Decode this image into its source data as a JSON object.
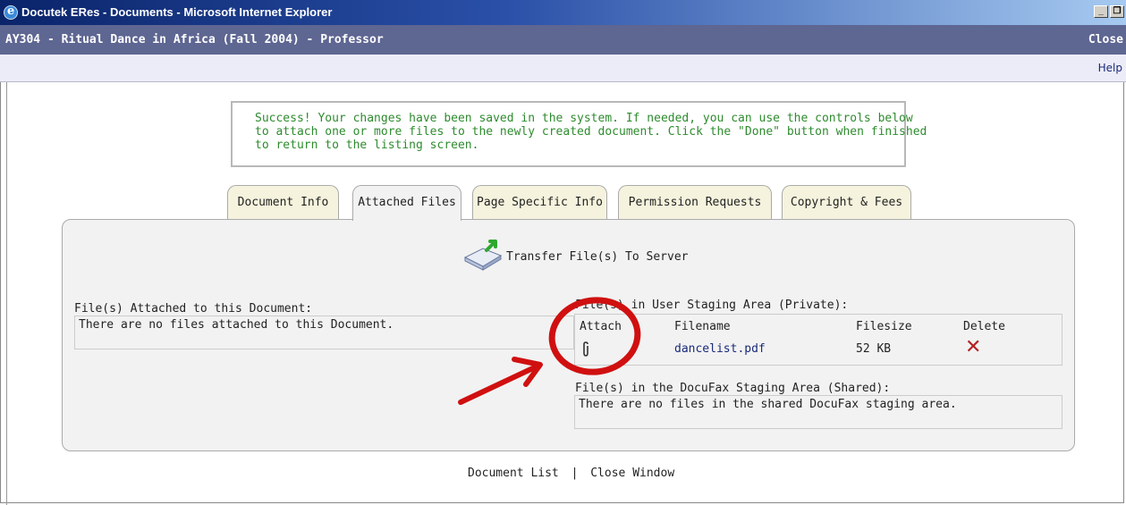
{
  "window": {
    "title": "Docutek ERes - Documents - Microsoft Internet Explorer",
    "min_glyph": "_",
    "restore_glyph": "❐"
  },
  "header": {
    "course_title": "AY304 - Ritual Dance in Africa (Fall 2004) - Professor",
    "close_label": "Close",
    "help_label": "Help"
  },
  "message": {
    "lines": [
      "Success! Your changes have been saved in the system. If needed, you can use the controls below",
      "to attach one or more files to the newly created document. Click the \"Done\" button when finished",
      "to return to the listing screen."
    ]
  },
  "tabs": [
    {
      "label": "Document Info",
      "active": false
    },
    {
      "label": "Attached Files",
      "active": true
    },
    {
      "label": "Page Specific Info",
      "active": false
    },
    {
      "label": "Permission Requests",
      "active": false
    },
    {
      "label": "Copyright & Fees",
      "active": false
    }
  ],
  "transfer": {
    "label": "Transfer File(s) To Server",
    "icon": "upload-to-server-icon"
  },
  "attached": {
    "label": "File(s) Attached to this Document:",
    "empty_text": "There are no files attached to this Document."
  },
  "staging": {
    "label": "File(s) in User Staging Area (Private):",
    "columns": [
      "Attach",
      "Filename",
      "Filesize",
      "Delete"
    ],
    "rows": [
      {
        "filename": "dancelist.pdf",
        "filesize": "52 KB",
        "attach_icon": "paperclip-icon",
        "delete_icon": "delete-x-icon"
      }
    ]
  },
  "docufax": {
    "label": "File(s) in the DocuFax Staging Area (Shared):",
    "empty_text": "There are no files in the shared DocuFax staging area."
  },
  "footer": {
    "document_list": "Document List",
    "separator": "|",
    "close_window": "Close Window"
  },
  "colors": {
    "appbar": "#5e6692",
    "success_text": "#2e8b2e",
    "link": "#1a2a7a",
    "delete": "#b22222",
    "annotation": "#d01010"
  }
}
